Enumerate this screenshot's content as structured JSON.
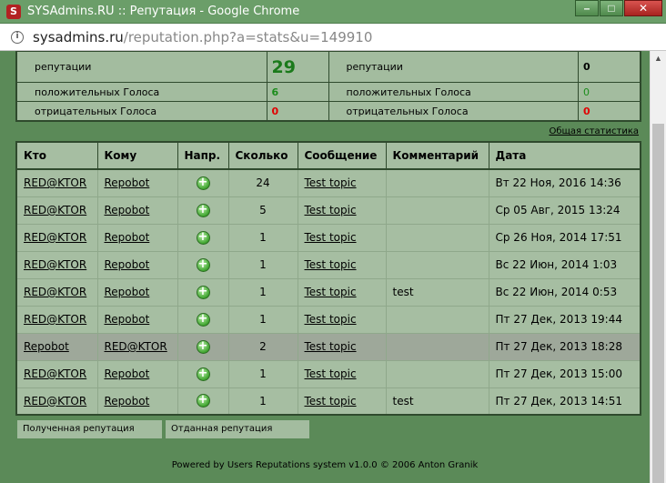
{
  "window": {
    "app_icon_letter": "S",
    "title": "SYSAdmins.RU :: Репутация - Google Chrome",
    "controls": {
      "minimize": "–",
      "maximize": "□",
      "close": "✕"
    }
  },
  "address": {
    "host": "sysadmins.ru",
    "path": "/reputation.php?a=stats&u=149910",
    "info_icon": "i"
  },
  "summary": {
    "rows": [
      {
        "label_left": "репутации",
        "value_left": "29",
        "label_right": "репутации",
        "value_right": "0"
      },
      {
        "label_left": "положительных Голоса",
        "value_left": "6",
        "label_right": "положительных Голоса",
        "value_right": "0"
      },
      {
        "label_left": "отрицательных Голоса",
        "value_left": "0",
        "label_right": "отрицательных Голоса",
        "value_right": "0"
      }
    ]
  },
  "stats_link": "Общая статистика",
  "table": {
    "headers": [
      "Кто",
      "Кому",
      "Напр.",
      "Сколько",
      "Сообщение",
      "Комментарий",
      "Дата"
    ],
    "rows": [
      {
        "who": "RED@KTOR",
        "to": "Repobot",
        "count": "24",
        "message": "Test topic",
        "comment": "",
        "date": "Вт 22 Ноя, 2016 14:36"
      },
      {
        "who": "RED@KTOR",
        "to": "Repobot",
        "count": "5",
        "message": "Test topic",
        "comment": "",
        "date": "Ср 05 Авг, 2015 13:24"
      },
      {
        "who": "RED@KTOR",
        "to": "Repobot",
        "count": "1",
        "message": "Test topic",
        "comment": "",
        "date": "Ср 26 Ноя, 2014 17:51"
      },
      {
        "who": "RED@KTOR",
        "to": "Repobot",
        "count": "1",
        "message": "Test topic",
        "comment": "",
        "date": "Вс 22 Июн, 2014 1:03"
      },
      {
        "who": "RED@KTOR",
        "to": "Repobot",
        "count": "1",
        "message": "Test topic",
        "comment": "test",
        "date": "Вс 22 Июн, 2014 0:53"
      },
      {
        "who": "RED@KTOR",
        "to": "Repobot",
        "count": "1",
        "message": "Test topic",
        "comment": "",
        "date": "Пт 27 Дек, 2013 19:44"
      },
      {
        "who": "Repobot",
        "to": "RED@KTOR",
        "count": "2",
        "message": "Test topic",
        "comment": "",
        "date": "Пт 27 Дек, 2013 18:28"
      },
      {
        "who": "RED@KTOR",
        "to": "Repobot",
        "count": "1",
        "message": "Test topic",
        "comment": "",
        "date": "Пт 27 Дек, 2013 15:00"
      },
      {
        "who": "RED@KTOR",
        "to": "Repobot",
        "count": "1",
        "message": "Test topic",
        "comment": "test",
        "date": "Пт 27 Дек, 2013 14:51"
      }
    ],
    "direction_icon": "plus-circle-icon",
    "direction_glyph": "+"
  },
  "tabs": [
    "Полученная репутация",
    "Отданная репутация"
  ],
  "footer": "Powered by Users Reputations system v1.0.0 © 2006 Anton Granik",
  "colors": {
    "page_bg": "#5b8a58",
    "panel_bg": "#a6bea2",
    "positive": "#1b8c1b",
    "negative": "#e00000"
  }
}
